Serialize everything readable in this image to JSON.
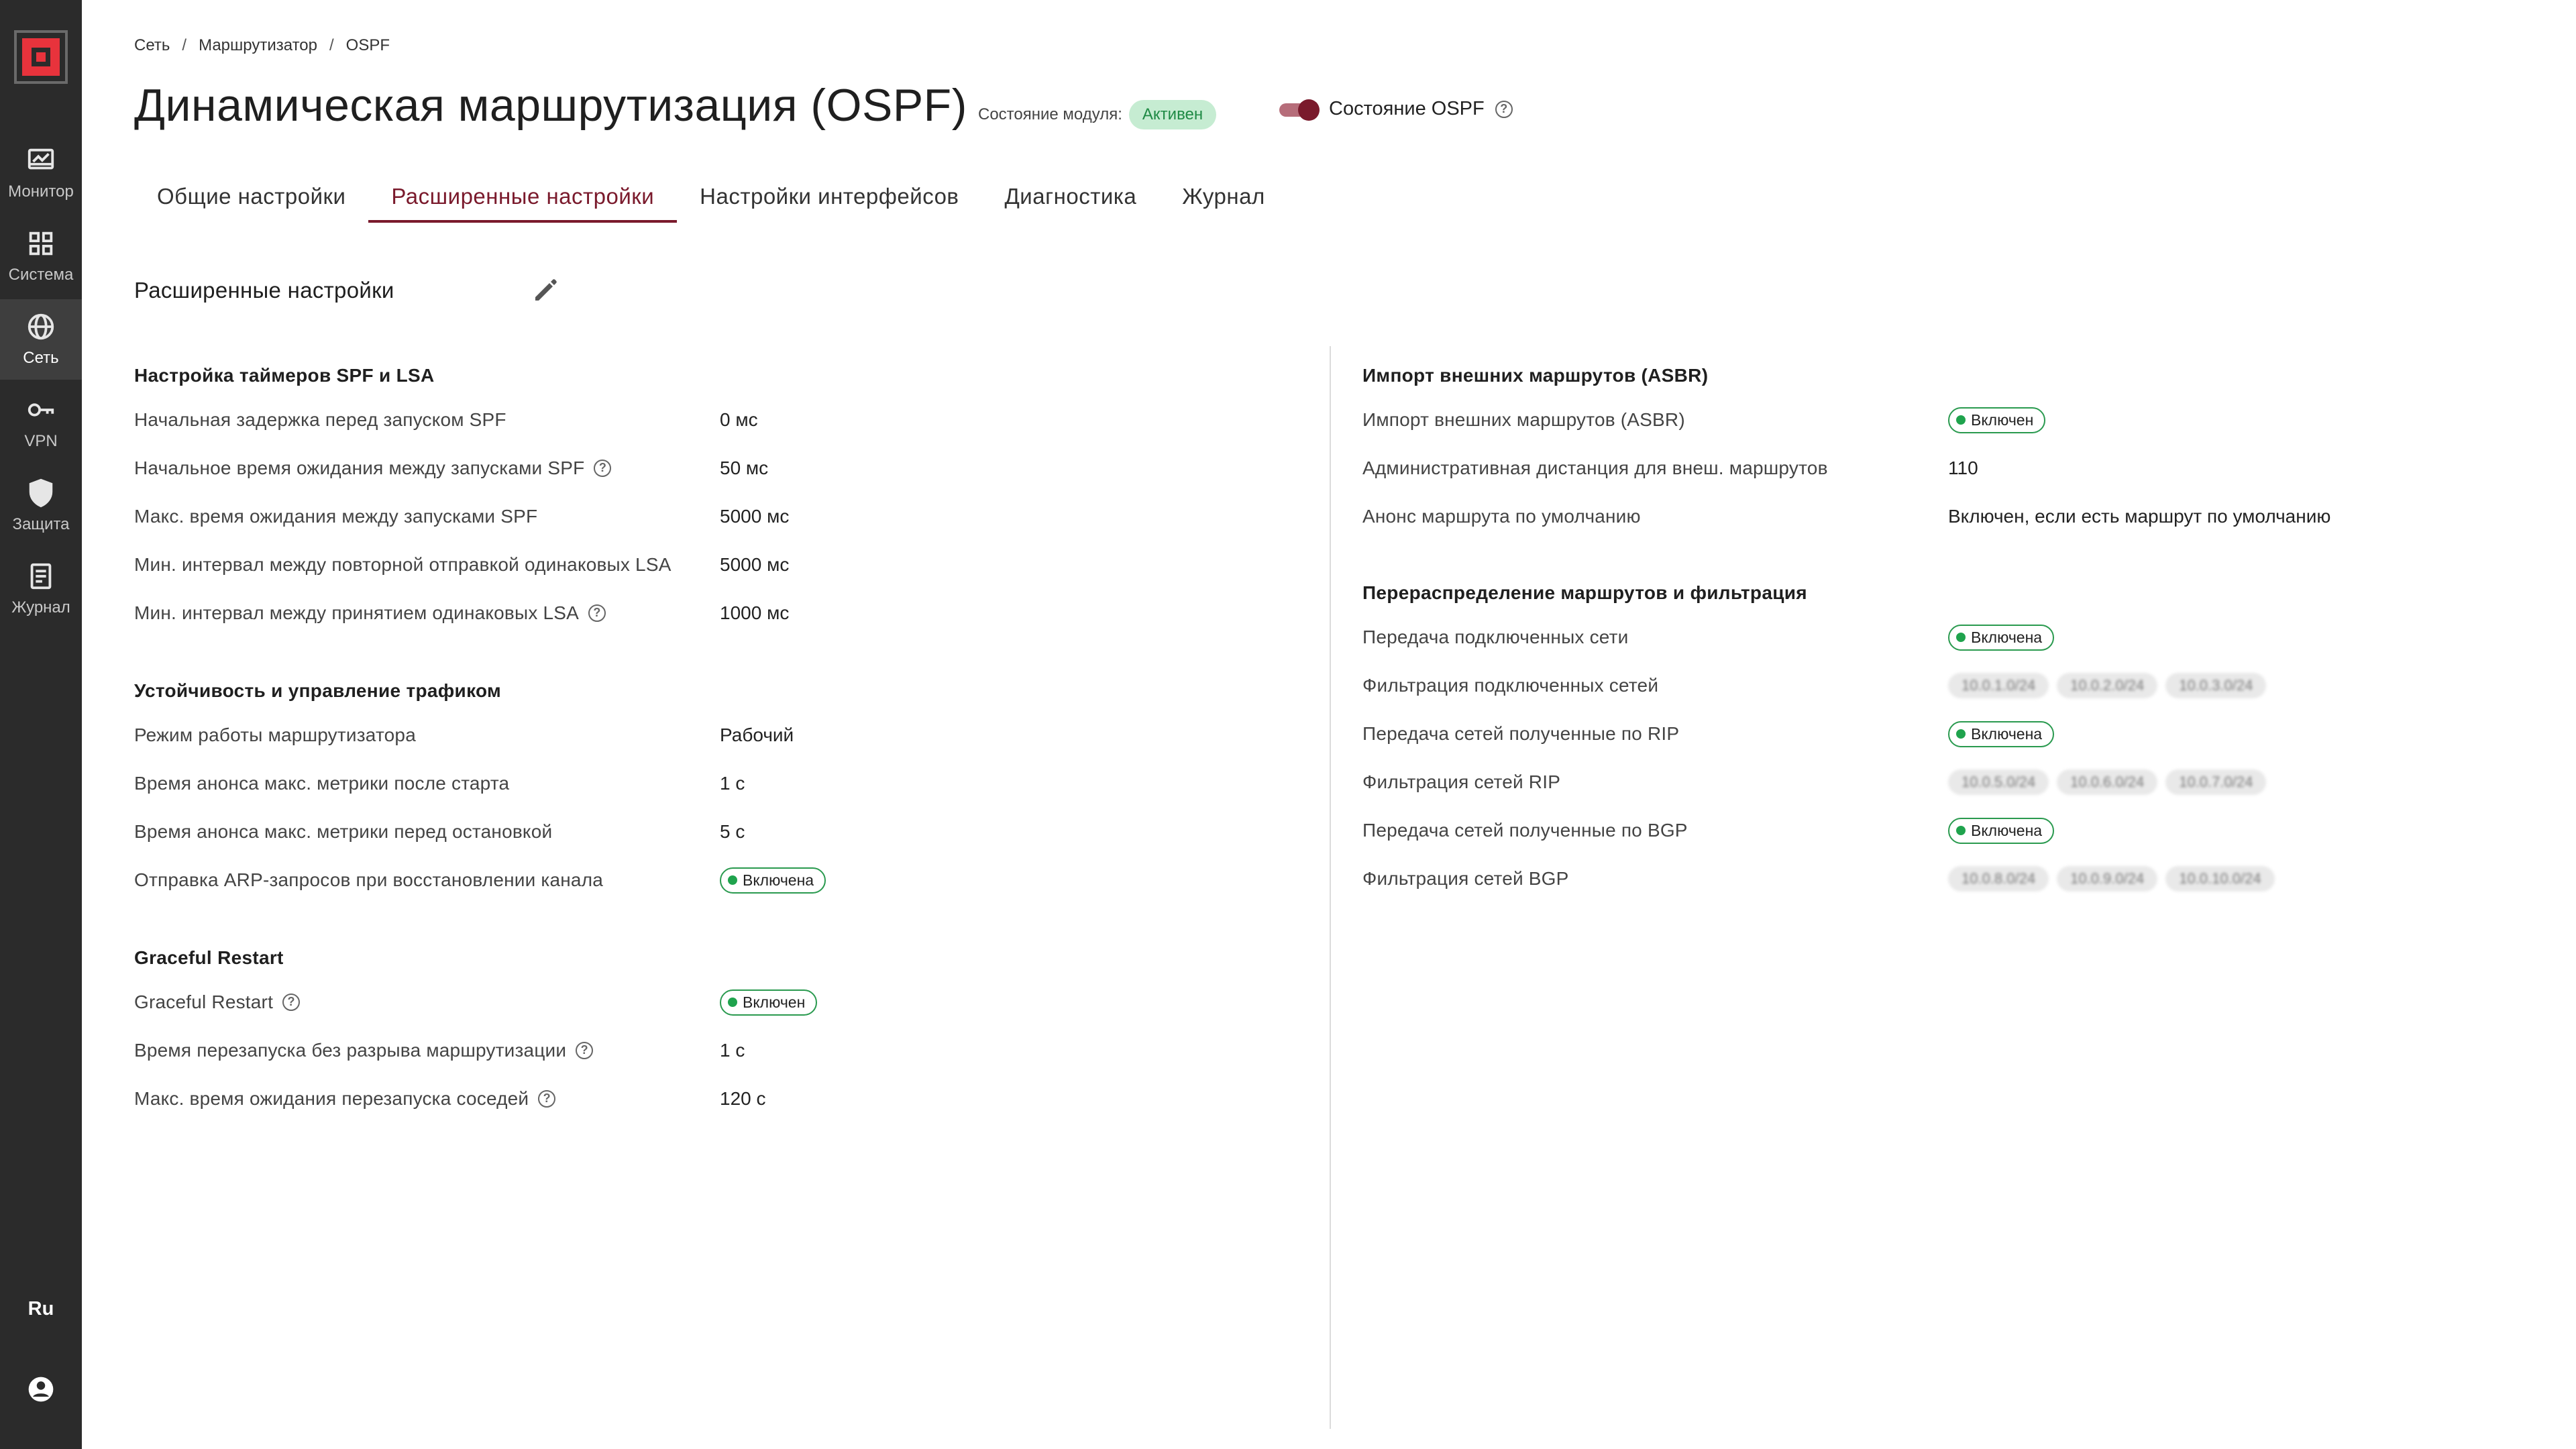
{
  "sidebar": {
    "items": [
      {
        "label": "Монитор",
        "icon": "monitor-icon"
      },
      {
        "label": "Система",
        "icon": "grid-icon"
      },
      {
        "label": "Сеть",
        "icon": "globe-icon"
      },
      {
        "label": "VPN",
        "icon": "key-icon"
      },
      {
        "label": "Защита",
        "icon": "shield-icon"
      },
      {
        "label": "Журнал",
        "icon": "journal-icon"
      }
    ],
    "language": "Ru"
  },
  "breadcrumb": [
    "Сеть",
    "Маршрутизатор",
    "OSPF"
  ],
  "header": {
    "title": "Динамическая маршрутизация (OSPF)",
    "module_state_label": "Состояние модуля:",
    "module_state_value": "Активен",
    "ospf_state_label": "Состояние OSPF"
  },
  "tabs": [
    "Общие настройки",
    "Расширенные настройки",
    "Настройки интерфейсов",
    "Диагностика",
    "Журнал"
  ],
  "section_title": "Расширенные настройки",
  "left": {
    "timers": {
      "title": "Настройка таймеров SPF и LSA",
      "rows": [
        {
          "label": "Начальная задержка перед запуском SPF",
          "value": "0 мс"
        },
        {
          "label": "Начальное время ожидания между запусками SPF",
          "value": "50 мс"
        },
        {
          "label": "Макс. время ожидания между запусками SPF",
          "value": "5000 мс"
        },
        {
          "label": "Мин. интервал между повторной отправкой одинаковых LSA",
          "value": "5000 мс"
        },
        {
          "label": "Мин. интервал между принятием одинаковых LSA",
          "value": "1000 мс"
        }
      ]
    },
    "stability": {
      "title": "Устойчивость и управление трафиком",
      "rows": [
        {
          "label": "Режим работы маршрутизатора",
          "value": "Рабочий"
        },
        {
          "label": "Время анонса макс. метрики после старта",
          "value": "1 с"
        },
        {
          "label": "Время анонса макс. метрики перед остановкой",
          "value": "5 с"
        },
        {
          "label": "Отправка ARP-запросов при восстановлении канала",
          "value": "Включена"
        }
      ]
    },
    "graceful": {
      "title": "Graceful Restart",
      "rows": [
        {
          "label": "Graceful Restart",
          "value": "Включен"
        },
        {
          "label": "Время перезапуска без разрыва маршрутизации",
          "value": "1 с"
        },
        {
          "label": "Макс. время ожидания перезапуска соседей",
          "value": "120 с"
        }
      ]
    }
  },
  "right": {
    "asbr": {
      "title": "Импорт внешних маршрутов (ASBR)",
      "rows": [
        {
          "label": "Импорт внешних маршрутов (ASBR)",
          "value": "Включен"
        },
        {
          "label": "Административная дистанция для внеш. маршрутов",
          "value": "110"
        },
        {
          "label": "Анонс маршрута по умолчанию",
          "value": "Включен, если есть маршрут по умолчанию"
        }
      ]
    },
    "redistribution": {
      "title": "Перераспределение маршрутов и фильтрация",
      "rows": [
        {
          "label": "Передача подключенных сети",
          "value": "Включена"
        },
        {
          "label": "Фильтрация подключенных сетей",
          "chips": [
            "10.0.1.0/24",
            "10.0.2.0/24",
            "10.0.3.0/24"
          ]
        },
        {
          "label": "Передача сетей полученные по RIP",
          "value": "Включена"
        },
        {
          "label": "Фильтрация сетей RIP",
          "chips": [
            "10.0.5.0/24",
            "10.0.6.0/24",
            "10.0.7.0/24"
          ]
        },
        {
          "label": "Передача сетей полученные по BGP",
          "value": "Включена"
        },
        {
          "label": "Фильтрация сетей BGP",
          "chips": [
            "10.0.8.0/24",
            "10.0.9.0/24",
            "10.0.10.0/24"
          ]
        }
      ]
    }
  },
  "colors": {
    "accent": "#7a1a2c",
    "sidebar": "#2b2b2b",
    "success": "#1fa34d",
    "active_pill_bg": "#c6ecd2"
  }
}
